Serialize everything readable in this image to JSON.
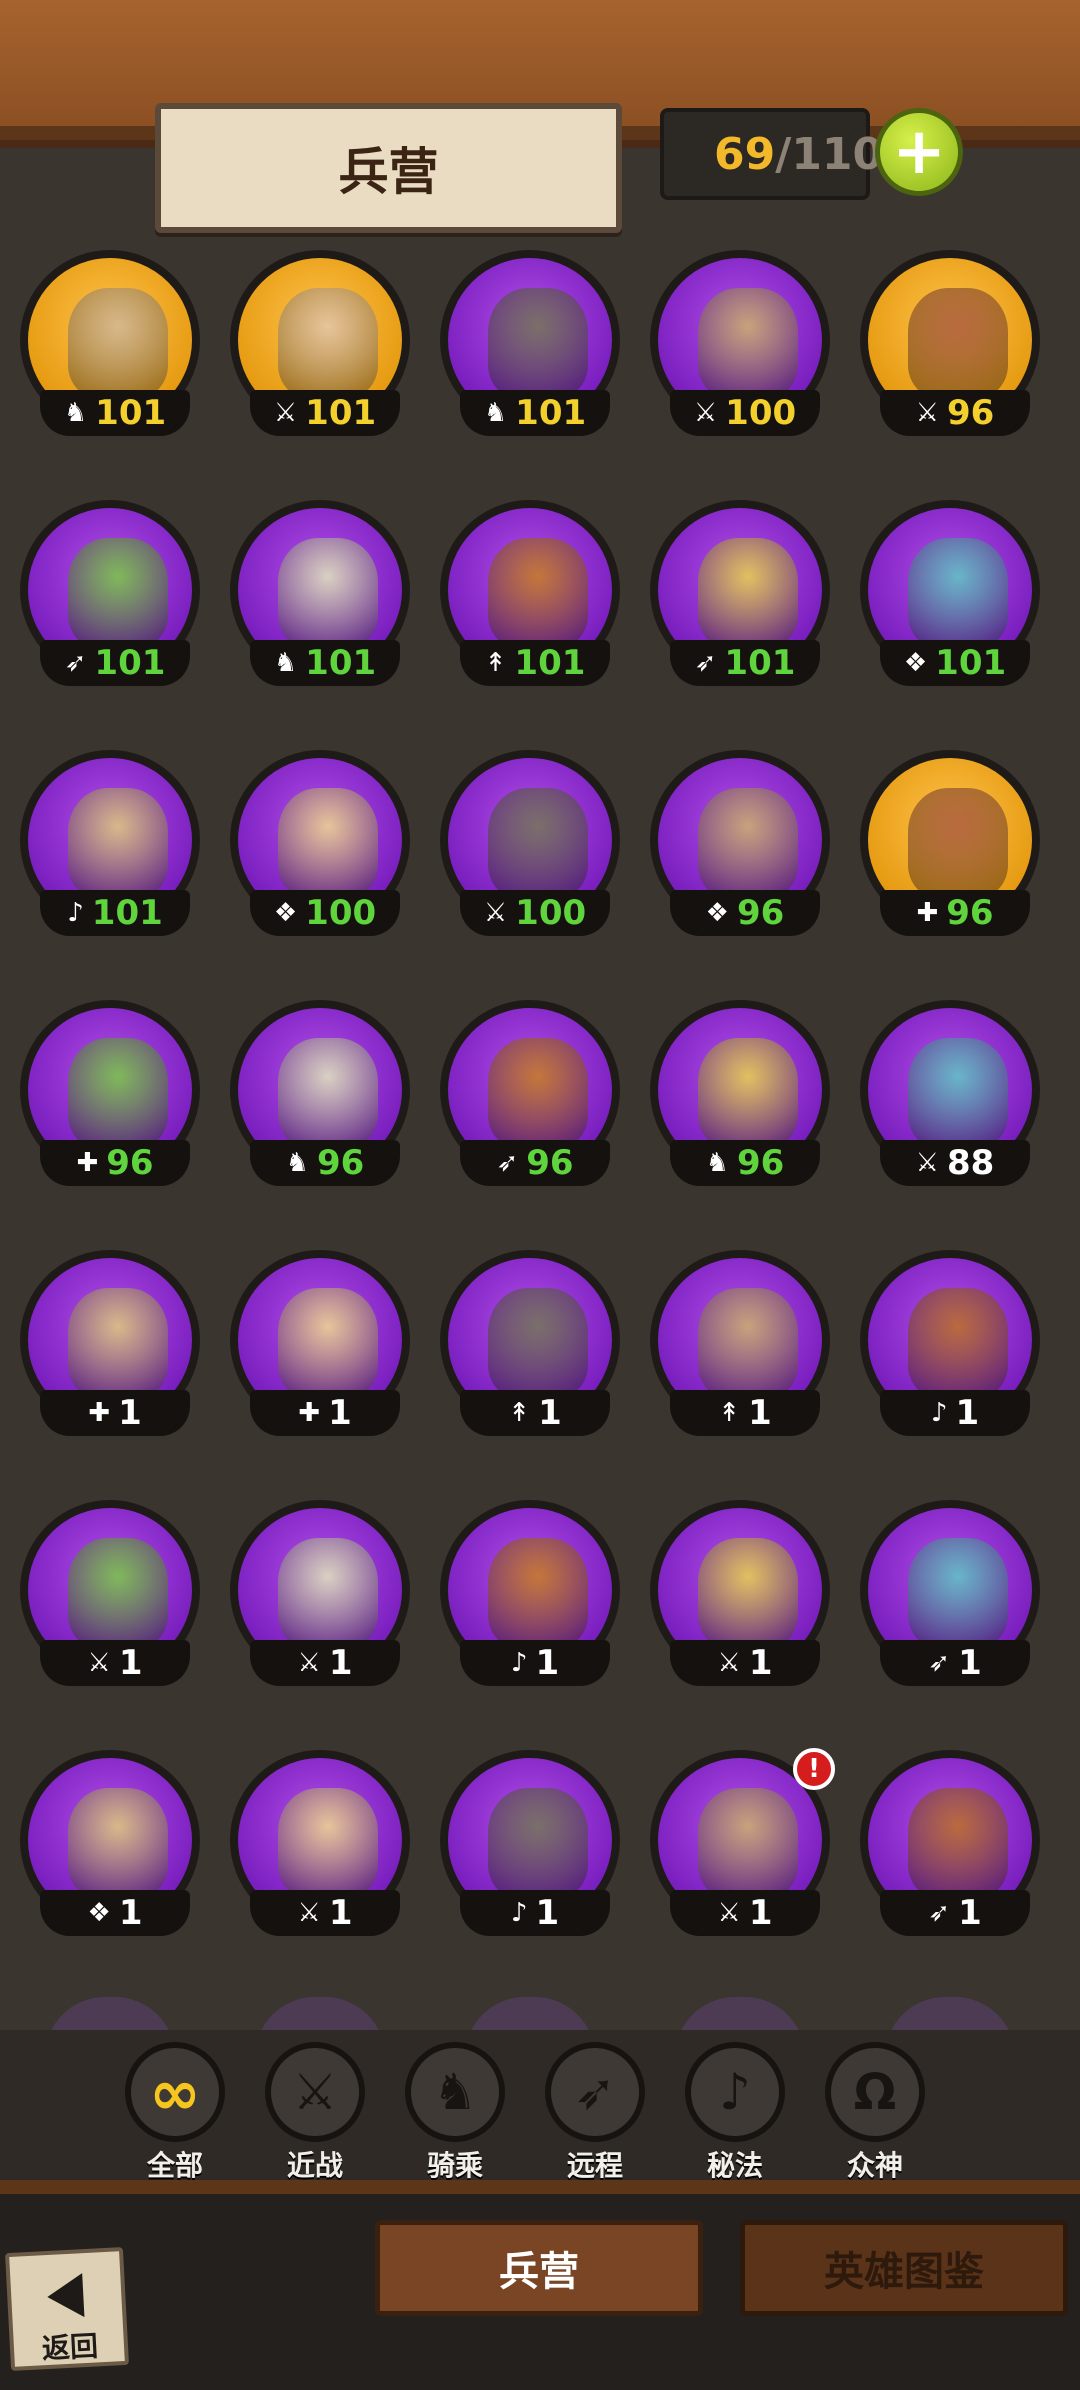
{
  "header": {
    "title": "兵营",
    "count_current": "69",
    "count_separator": "/",
    "count_max": "110",
    "plus_label": "+"
  },
  "colors": {
    "gold_frame": "#e69b12",
    "purple_frame": "#7a1fbf",
    "level_yellow": "#f3d02c",
    "level_green": "#5fd43d",
    "level_white": "#ffffff"
  },
  "heroes": [
    {
      "frame": "gold",
      "cls": "cavalry-icon",
      "glyph": "♞",
      "level": "101",
      "lvl_color": "yellow"
    },
    {
      "frame": "gold",
      "cls": "melee-icon",
      "glyph": "⚔",
      "level": "101",
      "lvl_color": "yellow"
    },
    {
      "frame": "purple",
      "cls": "cavalry-icon",
      "glyph": "♞",
      "level": "101",
      "lvl_color": "yellow"
    },
    {
      "frame": "purple",
      "cls": "melee-icon",
      "glyph": "⚔",
      "level": "100",
      "lvl_color": "yellow"
    },
    {
      "frame": "gold",
      "cls": "melee-icon",
      "glyph": "⚔",
      "level": "96",
      "lvl_color": "yellow"
    },
    {
      "frame": "purple",
      "cls": "ranged-icon",
      "glyph": "➶",
      "level": "101",
      "lvl_color": "green"
    },
    {
      "frame": "purple",
      "cls": "cavalry-icon",
      "glyph": "♞",
      "level": "101",
      "lvl_color": "green"
    },
    {
      "frame": "purple",
      "cls": "spear-icon",
      "glyph": "↟",
      "level": "101",
      "lvl_color": "green"
    },
    {
      "frame": "purple",
      "cls": "ranged-icon",
      "glyph": "➶",
      "level": "101",
      "lvl_color": "green"
    },
    {
      "frame": "purple",
      "cls": "beast-icon",
      "glyph": "❖",
      "level": "101",
      "lvl_color": "green"
    },
    {
      "frame": "purple",
      "cls": "magic-icon",
      "glyph": "♪",
      "level": "101",
      "lvl_color": "green"
    },
    {
      "frame": "purple",
      "cls": "beast-icon",
      "glyph": "❖",
      "level": "100",
      "lvl_color": "green"
    },
    {
      "frame": "purple",
      "cls": "melee-icon",
      "glyph": "⚔",
      "level": "100",
      "lvl_color": "green"
    },
    {
      "frame": "purple",
      "cls": "beast-icon",
      "glyph": "❖",
      "level": "96",
      "lvl_color": "green"
    },
    {
      "frame": "gold",
      "cls": "healer-icon",
      "glyph": "✚",
      "level": "96",
      "lvl_color": "green"
    },
    {
      "frame": "purple",
      "cls": "healer-icon",
      "glyph": "✚",
      "level": "96",
      "lvl_color": "green"
    },
    {
      "frame": "purple",
      "cls": "cavalry-icon",
      "glyph": "♞",
      "level": "96",
      "lvl_color": "green"
    },
    {
      "frame": "purple",
      "cls": "ranged-icon",
      "glyph": "➶",
      "level": "96",
      "lvl_color": "green"
    },
    {
      "frame": "purple",
      "cls": "cavalry-icon",
      "glyph": "♞",
      "level": "96",
      "lvl_color": "green"
    },
    {
      "frame": "purple",
      "cls": "melee-icon",
      "glyph": "⚔",
      "level": "88",
      "lvl_color": "white"
    },
    {
      "frame": "purple",
      "cls": "healer-icon",
      "glyph": "✚",
      "level": "1",
      "lvl_color": "white"
    },
    {
      "frame": "purple",
      "cls": "healer-icon",
      "glyph": "✚",
      "level": "1",
      "lvl_color": "white"
    },
    {
      "frame": "purple",
      "cls": "spear-icon",
      "glyph": "↟",
      "level": "1",
      "lvl_color": "white"
    },
    {
      "frame": "purple",
      "cls": "spear-icon",
      "glyph": "↟",
      "level": "1",
      "lvl_color": "white"
    },
    {
      "frame": "purple",
      "cls": "magic-icon",
      "glyph": "♪",
      "level": "1",
      "lvl_color": "white"
    },
    {
      "frame": "purple",
      "cls": "melee-icon",
      "glyph": "⚔",
      "level": "1",
      "lvl_color": "white"
    },
    {
      "frame": "purple",
      "cls": "melee-icon",
      "glyph": "⚔",
      "level": "1",
      "lvl_color": "white"
    },
    {
      "frame": "purple",
      "cls": "magic-icon",
      "glyph": "♪",
      "level": "1",
      "lvl_color": "white"
    },
    {
      "frame": "purple",
      "cls": "melee-icon",
      "glyph": "⚔",
      "level": "1",
      "lvl_color": "white"
    },
    {
      "frame": "purple",
      "cls": "ranged-icon",
      "glyph": "➶",
      "level": "1",
      "lvl_color": "white"
    },
    {
      "frame": "purple",
      "cls": "beast-icon",
      "glyph": "❖",
      "level": "1",
      "lvl_color": "white"
    },
    {
      "frame": "purple",
      "cls": "melee-icon",
      "glyph": "⚔",
      "level": "1",
      "lvl_color": "white"
    },
    {
      "frame": "purple",
      "cls": "magic-icon",
      "glyph": "♪",
      "level": "1",
      "lvl_color": "white"
    },
    {
      "frame": "purple",
      "cls": "melee-icon",
      "glyph": "⚔",
      "level": "1",
      "lvl_color": "white",
      "alert": "!"
    },
    {
      "frame": "purple",
      "cls": "ranged-icon",
      "glyph": "➶",
      "level": "1",
      "lvl_color": "white"
    }
  ],
  "filters": [
    {
      "label": "全部",
      "icon": "∞",
      "name": "filter-all",
      "icon_name": "infinity-icon"
    },
    {
      "label": "近战",
      "icon": "⚔",
      "name": "filter-melee",
      "icon_name": "sword-icon"
    },
    {
      "label": "骑乘",
      "icon": "♞",
      "name": "filter-cavalry",
      "icon_name": "horse-icon"
    },
    {
      "label": "远程",
      "icon": "➶",
      "name": "filter-ranged",
      "icon_name": "bow-icon"
    },
    {
      "label": "秘法",
      "icon": "♪",
      "name": "filter-arcane",
      "icon_name": "arcane-icon"
    },
    {
      "label": "众神",
      "icon": "Ω",
      "name": "filter-gods",
      "icon_name": "omega-icon"
    }
  ],
  "tabs": {
    "barracks": "兵营",
    "codex": "英雄图鉴"
  },
  "back_label": "返回"
}
